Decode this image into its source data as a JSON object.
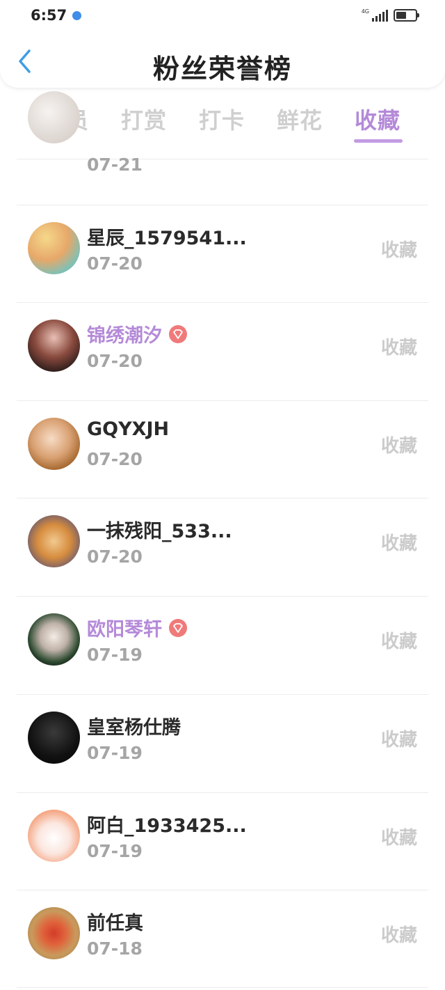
{
  "status_bar": {
    "time": "6:57",
    "network": "4G"
  },
  "header": {
    "title": "粉丝荣誉榜"
  },
  "tabs": [
    {
      "label": "会员",
      "active": false
    },
    {
      "label": "打赏",
      "active": false
    },
    {
      "label": "打卡",
      "active": false
    },
    {
      "label": "鲜花",
      "active": false
    },
    {
      "label": "收藏",
      "active": true
    }
  ],
  "list": {
    "partial_item": {
      "date": "07-21"
    },
    "items": [
      {
        "name": "星辰_1579541...",
        "date": "07-20",
        "action": "收藏",
        "vip": false
      },
      {
        "name": "锦绣潮汐",
        "date": "07-20",
        "action": "收藏",
        "vip": true
      },
      {
        "name": "GQYXJH",
        "date": "07-20",
        "action": "收藏",
        "vip": false
      },
      {
        "name": "一抹残阳_533...",
        "date": "07-20",
        "action": "收藏",
        "vip": false
      },
      {
        "name": "欧阳琴轩",
        "date": "07-19",
        "action": "收藏",
        "vip": true
      },
      {
        "name": "皇室杨仕腾",
        "date": "07-19",
        "action": "收藏",
        "vip": false
      },
      {
        "name": "阿白_1933425...",
        "date": "07-19",
        "action": "收藏",
        "vip": false
      },
      {
        "name": "前任真",
        "date": "07-18",
        "action": "收藏",
        "vip": false
      }
    ]
  },
  "colors": {
    "accent": "#b48ad8",
    "tab_inactive": "#cfcfcf",
    "back_arrow": "#3e9de6",
    "vip_badge": "#f07a7a"
  }
}
